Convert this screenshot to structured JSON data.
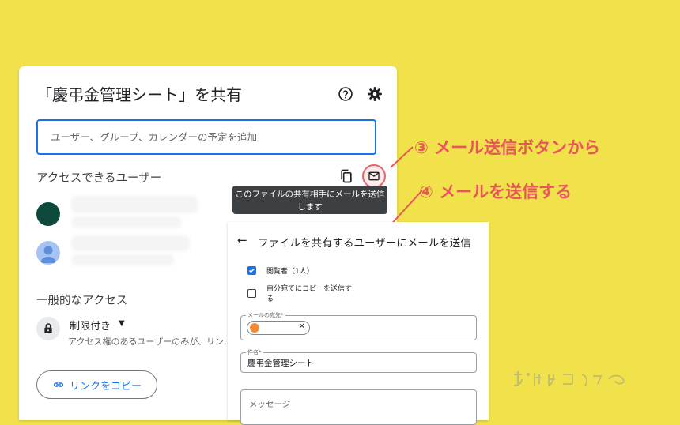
{
  "share_dialog": {
    "title": "「慶弔金管理シート」を共有",
    "search_placeholder": "ユーザー、グループ、カレンダーの予定を追加",
    "access_heading": "アクセスできるユーザー",
    "tooltip": "このファイルの共有相手にメールを送信します",
    "general_access_heading": "一般的なアクセス",
    "restriction_label": "制限付き",
    "restriction_desc": "アクセス権のあるユーザーのみが、リン…",
    "copy_link_label": "リンクをコピー"
  },
  "annotations": {
    "step3": "③ メール送信ボタンから",
    "step4": "④ メールを送信する"
  },
  "email_panel": {
    "title": "ファイルを共有するユーザーにメールを送信",
    "viewers_label": "閲覧者（1人）",
    "self_copy_label": "自分宛てにコピーを送信する",
    "to_legend": "メールの宛先*",
    "subject_legend": "件名*",
    "subject_value": "慶弔金管理シート",
    "message_placeholder": "メッセージ"
  },
  "icons": {
    "help": "help-circle-icon",
    "settings": "gear-icon",
    "copy": "copy-icon",
    "mail": "mail-icon",
    "lock": "lock-icon",
    "link": "link-icon",
    "back": "arrow-left-icon"
  },
  "colors": {
    "background": "#f1e14b",
    "accent_blue": "#1a73e8",
    "annotation_red": "#e7575a"
  }
}
